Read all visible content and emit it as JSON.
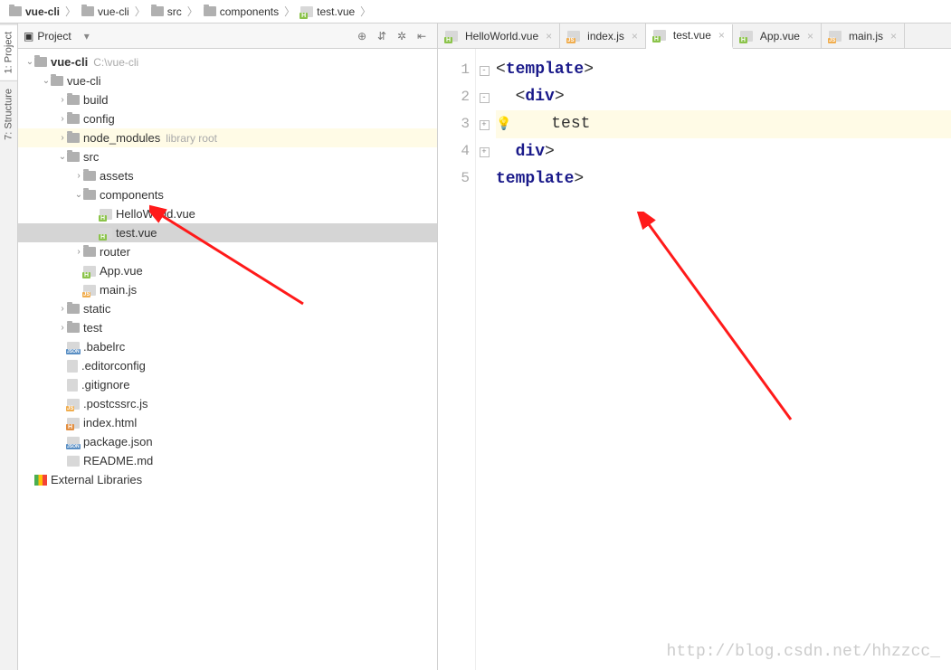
{
  "breadcrumbs": [
    {
      "icon": "folder",
      "label": "vue-cli"
    },
    {
      "icon": "folder",
      "label": "vue-cli"
    },
    {
      "icon": "folder",
      "label": "src"
    },
    {
      "icon": "folder",
      "label": "components"
    },
    {
      "icon": "vue",
      "label": "test.vue"
    }
  ],
  "side_tabs": {
    "project": "1: Project",
    "structure": "7: Structure"
  },
  "project_panel": {
    "title": "Project",
    "tree": [
      {
        "depth": 0,
        "arrow": "v",
        "icon": "folder",
        "label": "vue-cli",
        "hint": "C:\\vue-cli",
        "bold": true
      },
      {
        "depth": 1,
        "arrow": "v",
        "icon": "folder",
        "label": "vue-cli"
      },
      {
        "depth": 2,
        "arrow": ">",
        "icon": "folder",
        "label": "build"
      },
      {
        "depth": 2,
        "arrow": ">",
        "icon": "folder",
        "label": "config"
      },
      {
        "depth": 2,
        "arrow": ">",
        "icon": "folder",
        "label": "node_modules",
        "hint": "library root",
        "lib": true
      },
      {
        "depth": 2,
        "arrow": "v",
        "icon": "folder",
        "label": "src"
      },
      {
        "depth": 3,
        "arrow": ">",
        "icon": "folder",
        "label": "assets"
      },
      {
        "depth": 3,
        "arrow": "v",
        "icon": "folder",
        "label": "components"
      },
      {
        "depth": 4,
        "arrow": "",
        "icon": "vue",
        "label": "HelloWorld.vue"
      },
      {
        "depth": 4,
        "arrow": "",
        "icon": "vue",
        "label": "test.vue",
        "sel": true
      },
      {
        "depth": 3,
        "arrow": ">",
        "icon": "folder",
        "label": "router"
      },
      {
        "depth": 3,
        "arrow": "",
        "icon": "vue",
        "label": "App.vue"
      },
      {
        "depth": 3,
        "arrow": "",
        "icon": "js",
        "label": "main.js"
      },
      {
        "depth": 2,
        "arrow": ">",
        "icon": "folder",
        "label": "static"
      },
      {
        "depth": 2,
        "arrow": ">",
        "icon": "folder",
        "label": "test"
      },
      {
        "depth": 2,
        "arrow": "",
        "icon": "json",
        "label": ".babelrc"
      },
      {
        "depth": 2,
        "arrow": "",
        "icon": "file",
        "label": ".editorconfig"
      },
      {
        "depth": 2,
        "arrow": "",
        "icon": "file",
        "label": ".gitignore"
      },
      {
        "depth": 2,
        "arrow": "",
        "icon": "js",
        "label": ".postcssrc.js"
      },
      {
        "depth": 2,
        "arrow": "",
        "icon": "html",
        "label": "index.html"
      },
      {
        "depth": 2,
        "arrow": "",
        "icon": "json",
        "label": "package.json"
      },
      {
        "depth": 2,
        "arrow": "",
        "icon": "md",
        "label": "README.md"
      },
      {
        "depth": 0,
        "arrow": "",
        "icon": "libs",
        "label": "External Libraries"
      }
    ]
  },
  "editor_tabs": [
    {
      "icon": "vue",
      "label": "HelloWorld.vue",
      "active": false
    },
    {
      "icon": "js",
      "label": "index.js",
      "active": false
    },
    {
      "icon": "vue",
      "label": "test.vue",
      "active": true
    },
    {
      "icon": "vue",
      "label": "App.vue",
      "active": false
    },
    {
      "icon": "js",
      "label": "main.js",
      "active": false
    }
  ],
  "code": {
    "line_count": 5,
    "folds": [
      "-",
      "-",
      "",
      "+",
      "+"
    ],
    "lines": [
      {
        "segments": [
          {
            "c": "t-punc",
            "t": "<"
          },
          {
            "c": "t-tag",
            "t": "template"
          },
          {
            "c": "t-punc",
            "t": ">"
          }
        ],
        "indent": 0
      },
      {
        "segments": [
          {
            "c": "t-punc",
            "t": "<"
          },
          {
            "c": "t-tag",
            "t": "div"
          },
          {
            "c": "t-punc",
            "t": ">"
          }
        ],
        "indent": 1
      },
      {
        "segments": [
          {
            "c": "t-txt",
            "t": "test"
          }
        ],
        "indent": 2,
        "hl": true,
        "bulb": true
      },
      {
        "segments": [
          {
            "c": "t-punc",
            "t": "</"
          },
          {
            "c": "t-tag",
            "t": "div"
          },
          {
            "c": "t-punc",
            "t": ">"
          }
        ],
        "indent": 1
      },
      {
        "segments": [
          {
            "c": "t-punc",
            "t": "</"
          },
          {
            "c": "t-tag",
            "t": "template"
          },
          {
            "c": "t-punc",
            "t": ">"
          }
        ],
        "indent": 0
      }
    ]
  },
  "watermark": "http://blog.csdn.net/hhzzcc_"
}
